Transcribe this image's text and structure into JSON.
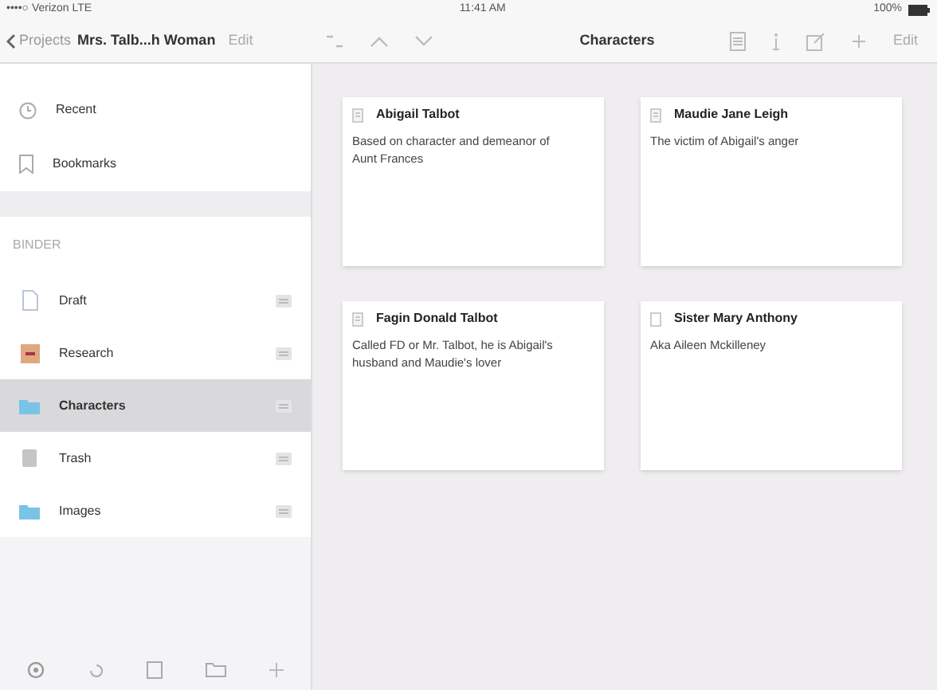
{
  "status_bar": {
    "carrier": "••••○ Verizon LTE",
    "time": "11:41 AM",
    "battery": "100%"
  },
  "nav": {
    "back": "Projects",
    "project_title": "Mrs. Talb...h Woman",
    "edit_left": "Edit",
    "title": "Characters",
    "edit_right": "Edit"
  },
  "sidebar": {
    "top_items": [
      {
        "label": "Recent",
        "kind": "recent"
      },
      {
        "label": "Bookmarks",
        "kind": "bookmark"
      }
    ],
    "binder_header": "BINDER",
    "binder_items": [
      {
        "label": "Draft",
        "kind": "draft",
        "selected": false
      },
      {
        "label": "Research",
        "kind": "research",
        "selected": false
      },
      {
        "label": "Characters",
        "kind": "folder",
        "selected": true
      },
      {
        "label": "Trash",
        "kind": "trash",
        "selected": false
      },
      {
        "label": "Images",
        "kind": "folder",
        "selected": false
      }
    ]
  },
  "cards": [
    {
      "title": "Abigail Talbot",
      "synopsis": "Based on character and demeanor of Aunt Frances",
      "kind": "doc"
    },
    {
      "title": "Maudie Jane Leigh",
      "synopsis": "The victim of Abigail's anger",
      "kind": "doc"
    },
    {
      "title": "Fagin Donald Talbot",
      "synopsis": "Called FD or Mr. Talbot, he is Abigail's husband and Maudie's lover",
      "kind": "doc"
    },
    {
      "title": "Sister Mary Anthony",
      "synopsis": "Aka Aileen Mckilleney",
      "kind": "blank"
    }
  ]
}
